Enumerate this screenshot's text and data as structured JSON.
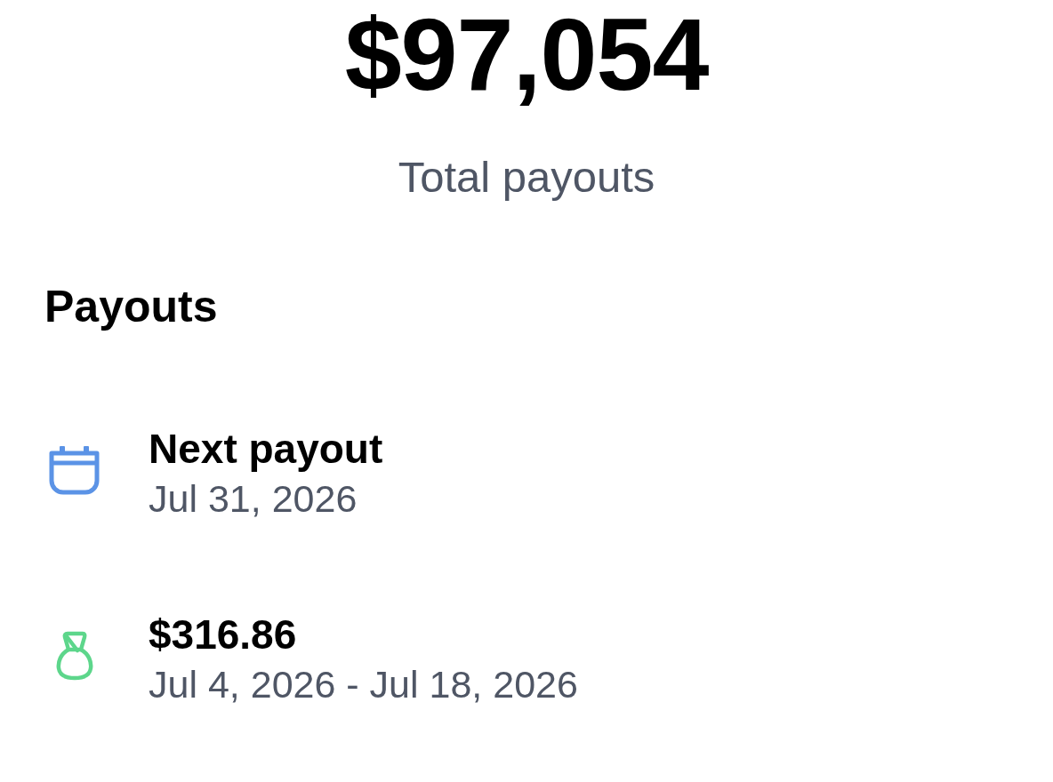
{
  "header": {
    "amount": "$97,054",
    "caption": "Total payouts"
  },
  "section": {
    "title": "Payouts"
  },
  "items": [
    {
      "kind": "calendar",
      "title": "Next payout",
      "subtitle": "Jul 31, 2026"
    },
    {
      "kind": "money_bag",
      "title": "$316.86",
      "subtitle": "Jul 4, 2026 - Jul 18, 2026"
    }
  ]
}
